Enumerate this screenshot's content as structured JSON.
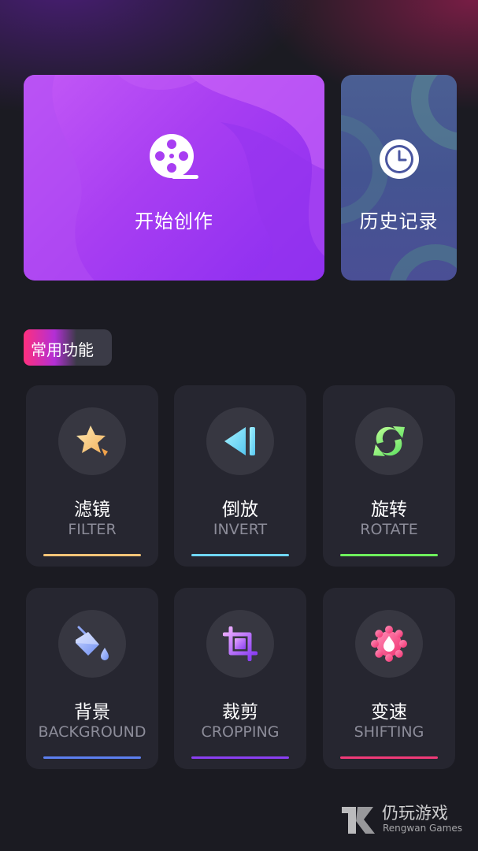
{
  "cards": {
    "create_label": "开始创作",
    "create_icon": "film-reel-icon",
    "history_label": "历史记录",
    "history_icon": "clock-icon"
  },
  "section": {
    "title": "常用功能"
  },
  "features": [
    {
      "zh": "滤镜",
      "en": "FILTER",
      "icon": "star-icon",
      "accent": "#f5c477"
    },
    {
      "zh": "倒放",
      "en": "INVERT",
      "icon": "reverse-play-icon",
      "accent": "#6fd6f7"
    },
    {
      "zh": "旋转",
      "en": "ROTATE",
      "icon": "rotate-icon",
      "accent": "#6ef05c"
    },
    {
      "zh": "背景",
      "en": "BACKGROUND",
      "icon": "paint-bucket-icon",
      "accent": "#5c7ff0"
    },
    {
      "zh": "裁剪",
      "en": "CROPPING",
      "icon": "crop-icon",
      "accent": "#8a3ff2"
    },
    {
      "zh": "变速",
      "en": "SHIFTING",
      "icon": "speed-drop-icon",
      "accent": "#f03a78"
    }
  ],
  "watermark": {
    "name": "仍玩游戏",
    "subtitle": "Rengwan Games"
  }
}
